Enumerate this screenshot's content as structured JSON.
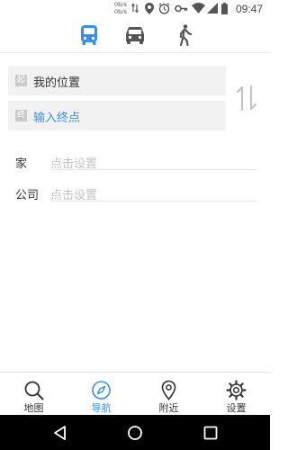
{
  "status_bar": {
    "net_up": "0b/s",
    "net_down": "0b/s",
    "time": "09:47",
    "icons": [
      "data-arrows-icon",
      "location-icon",
      "alarm-icon",
      "key-icon",
      "wifi-icon",
      "signal-icon",
      "battery-icon"
    ]
  },
  "mode_tabs": {
    "items": [
      {
        "name": "bus",
        "icon": "bus-icon",
        "active": true
      },
      {
        "name": "car",
        "icon": "car-icon",
        "active": false
      },
      {
        "name": "walk",
        "icon": "walk-icon",
        "active": false
      }
    ]
  },
  "route": {
    "start_badge": "起",
    "start_text": "我的位置",
    "end_badge": "终",
    "end_text": "输入终点"
  },
  "places": {
    "home_label": "家",
    "home_value": "点击设置",
    "company_label": "公司",
    "company_value": "点击设置"
  },
  "bottom_nav": {
    "items": [
      {
        "label": "地图",
        "icon": "search-icon",
        "active": false
      },
      {
        "label": "导航",
        "icon": "compass-icon",
        "active": true
      },
      {
        "label": "附近",
        "icon": "location-pin-icon",
        "active": false
      },
      {
        "label": "设置",
        "icon": "gear-icon",
        "active": false
      }
    ]
  },
  "colors": {
    "accent": "#3a8fe0",
    "inactive_icon": "#555555",
    "input_bg": "#f2f2f2",
    "placeholder": "#c3c3c3"
  }
}
